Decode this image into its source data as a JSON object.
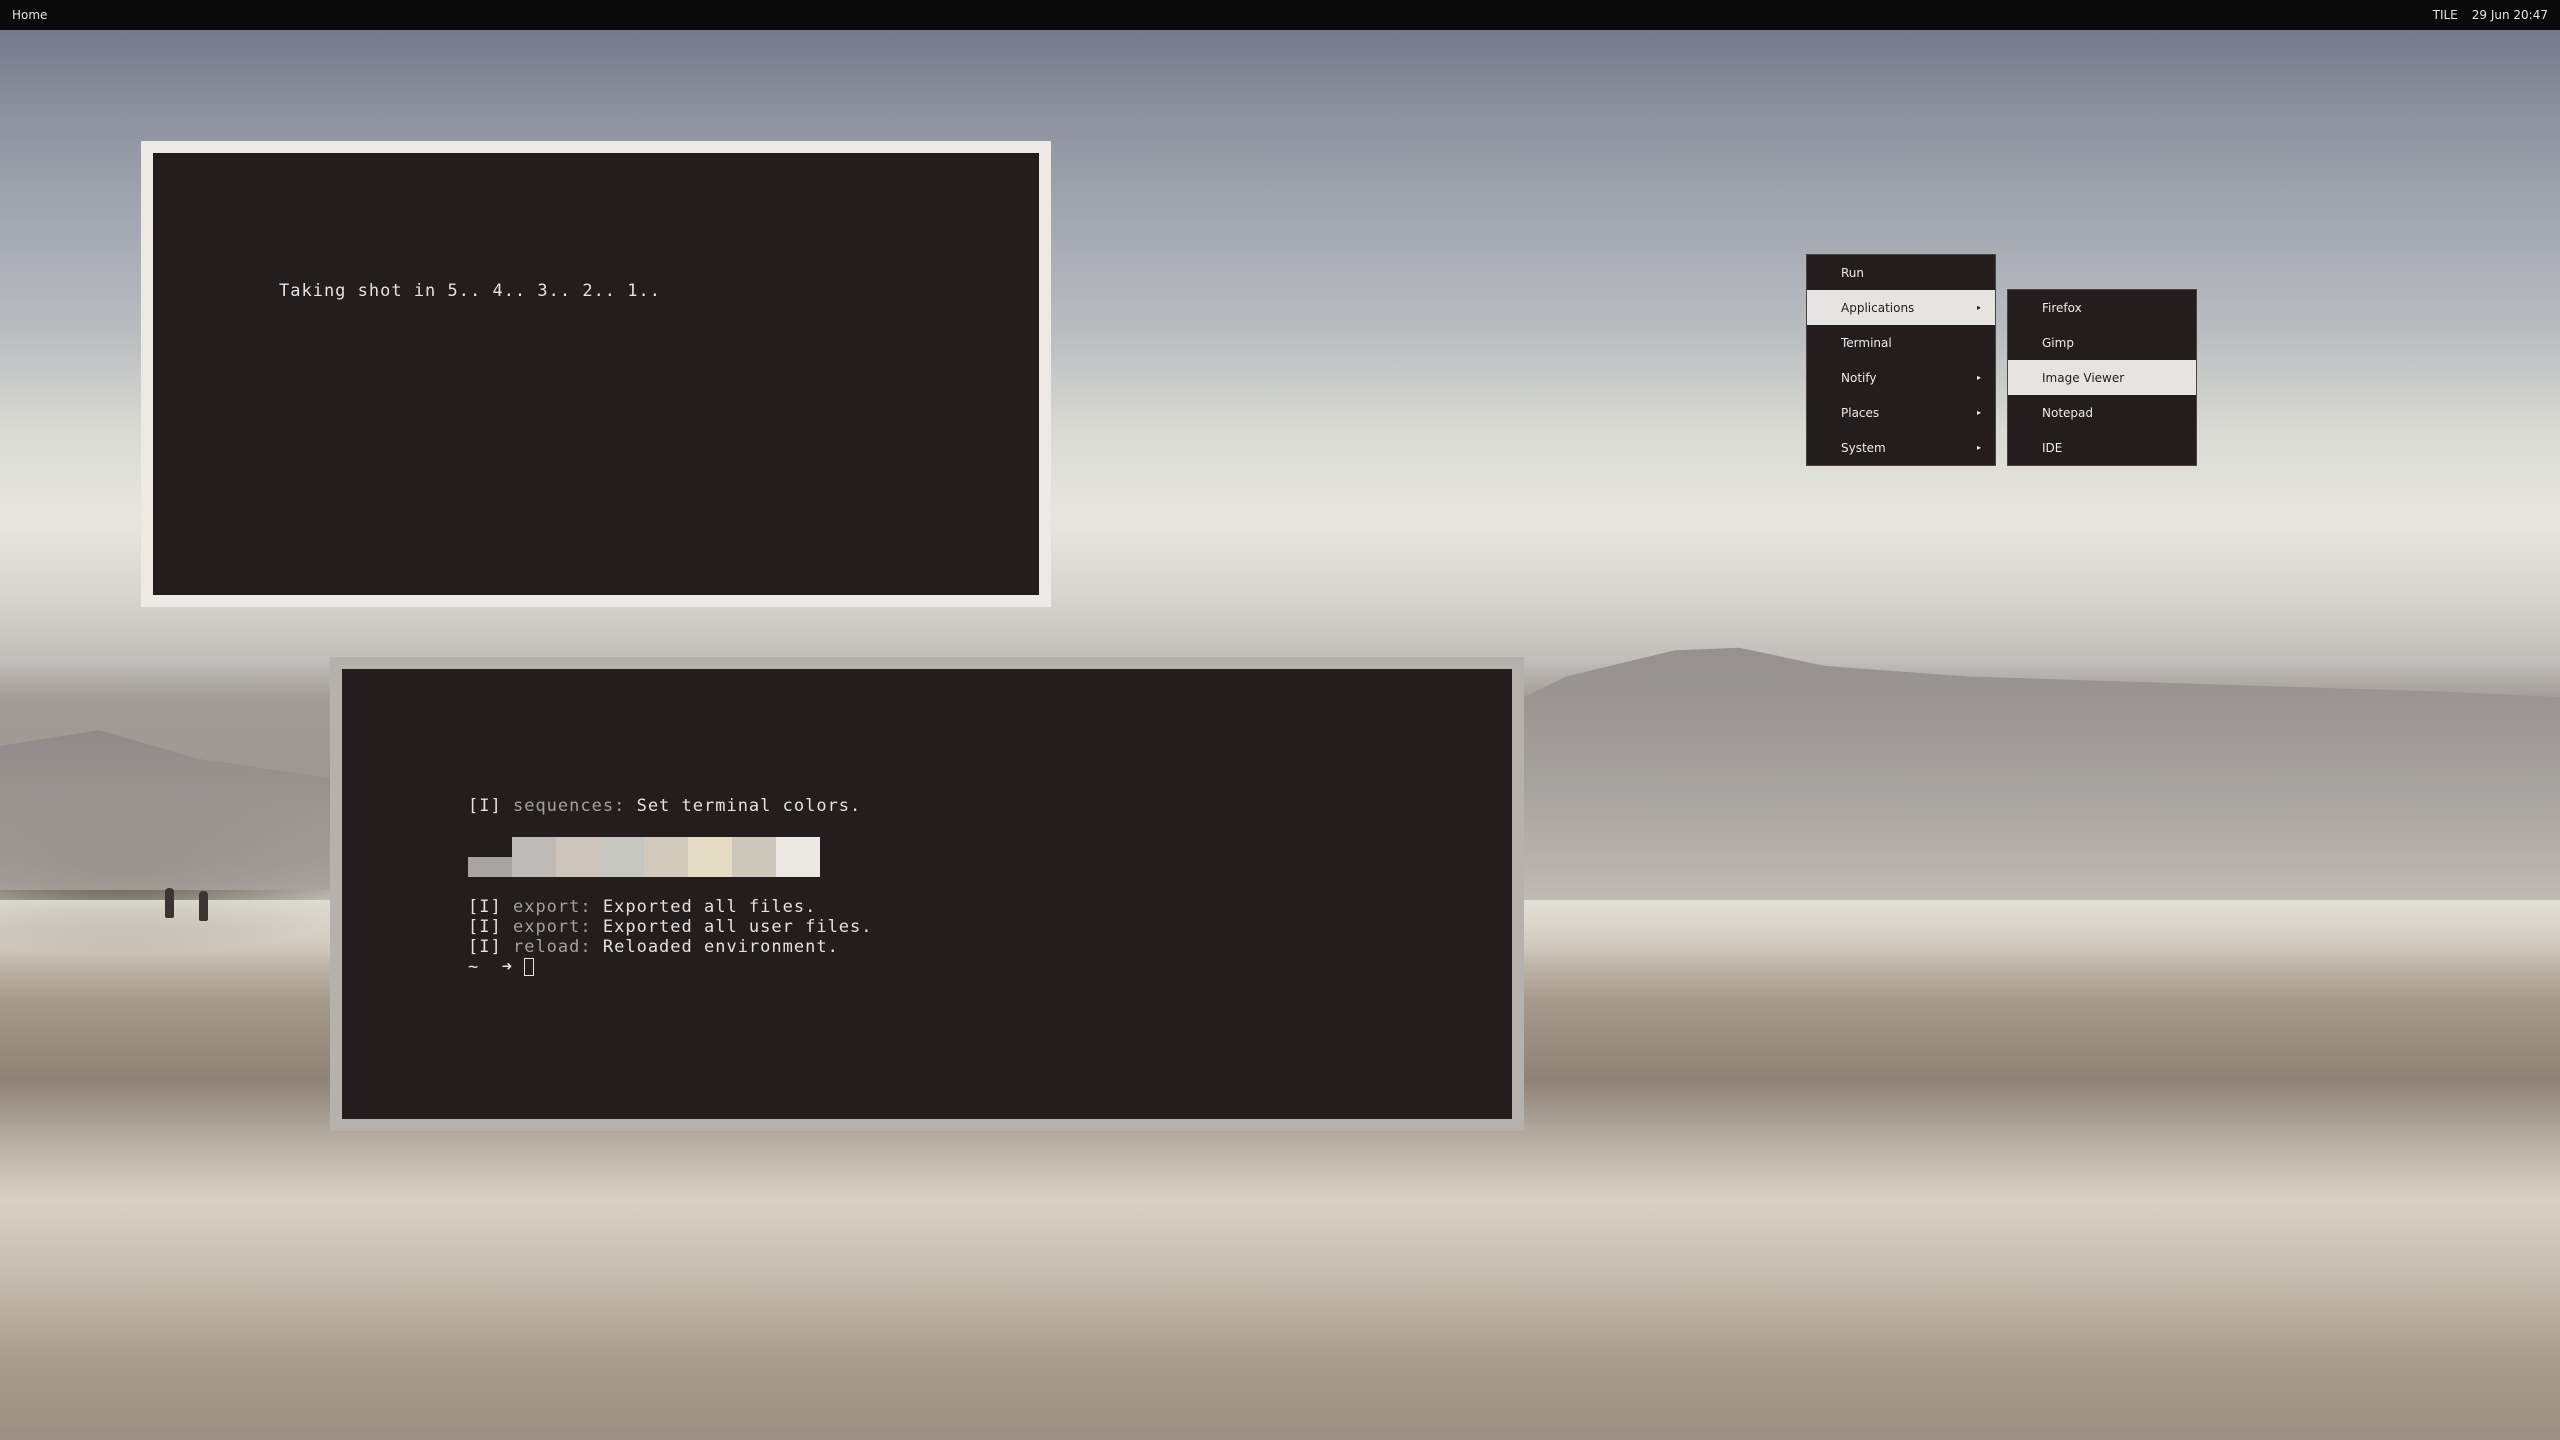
{
  "topbar": {
    "left_label": "Home",
    "layout_label": "TILE",
    "clock": "29 Jun 20:47"
  },
  "window_countdown": {
    "text": "Taking shot in 5.. 4.. 3.. 2.. 1.."
  },
  "window_terminal": {
    "lines_top": [
      {
        "tag": "[I]",
        "key": "sequences:",
        "msg": "Set terminal colors."
      }
    ],
    "swatches": [
      "#a8a4a1",
      "#bebbb8",
      "#cdc4bb",
      "#c6c7c1",
      "#d2cbbc",
      "#e4dcc2",
      "#ccc8bc",
      "#ece9e4"
    ],
    "lines_bottom": [
      {
        "tag": "[I]",
        "key": "export:",
        "msg": "Exported all files."
      },
      {
        "tag": "[I]",
        "key": "export:",
        "msg": "Exported all user files."
      },
      {
        "tag": "[I]",
        "key": "reload:",
        "msg": "Reloaded environment."
      }
    ],
    "prompt": "~  ➜ "
  },
  "menu_main": {
    "items": [
      {
        "label": "Run",
        "submenu": false
      },
      {
        "label": "Applications",
        "submenu": true,
        "highlighted": true
      },
      {
        "label": "Terminal",
        "submenu": false
      },
      {
        "label": "Notify",
        "submenu": true
      },
      {
        "label": "Places",
        "submenu": true
      },
      {
        "label": "System",
        "submenu": true
      }
    ],
    "arrow": "▸"
  },
  "menu_apps": {
    "items": [
      {
        "label": "Firefox"
      },
      {
        "label": "Gimp"
      },
      {
        "label": "Image Viewer",
        "highlighted": true
      },
      {
        "label": "Notepad"
      },
      {
        "label": "IDE"
      }
    ]
  }
}
